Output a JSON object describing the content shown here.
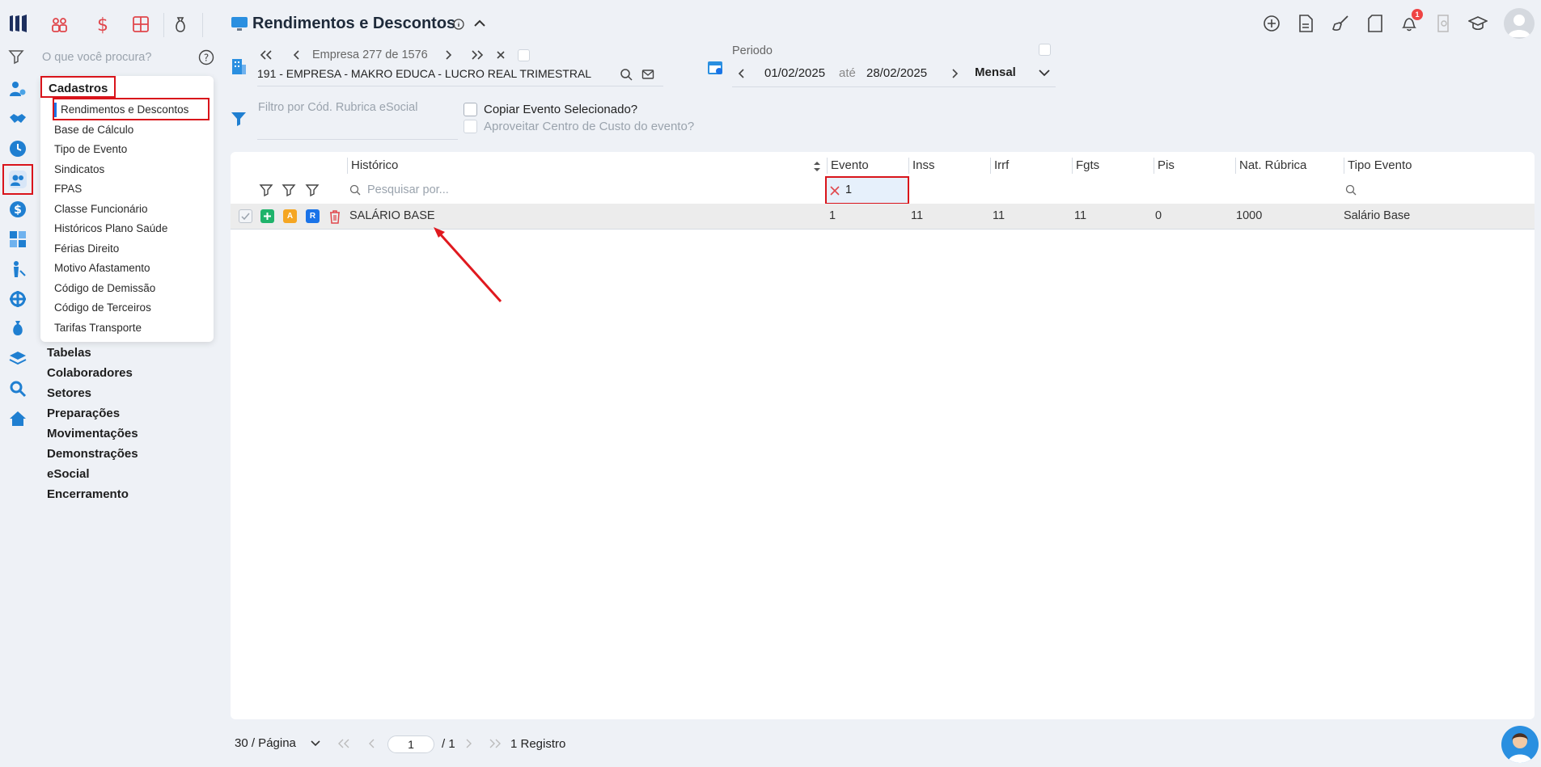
{
  "page": {
    "title": "Rendimentos e Descontos",
    "notification_count": "1"
  },
  "search": {
    "placeholder": "O que você procura?"
  },
  "menu": {
    "section_title": "Cadastros",
    "items": [
      "Rendimentos e Descontos",
      "Base de Cálculo",
      "Tipo de Evento",
      "Sindicatos",
      "FPAS",
      "Classe Funcionário",
      "Históricos Plano Saúde",
      "Férias Direito",
      "Motivo Afastamento",
      "Código de Demissão",
      "Código de Terceiros",
      "Tarifas Transporte"
    ],
    "main_items": [
      "Tabelas",
      "Colaboradores",
      "Setores",
      "Preparações",
      "Movimentações",
      "Demonstrações",
      "eSocial",
      "Encerramento"
    ]
  },
  "company": {
    "label": "Empresa",
    "current": "277",
    "of_label": "de",
    "total": "1576",
    "name": "191 - EMPRESA - MAKRO EDUCA - LUCRO REAL TRIMESTRAL"
  },
  "period": {
    "label": "Periodo",
    "start": "01/02/2025",
    "until_label": "até",
    "end": "28/02/2025",
    "mode": "Mensal"
  },
  "filter": {
    "placeholder": "Filtro por Cód. Rubrica eSocial",
    "copy_event_label": "Copiar Evento Selecionado?",
    "reuse_cost_center_label": "Aproveitar Centro de Custo do evento?"
  },
  "table": {
    "columns": [
      "Histórico",
      "Evento",
      "Inss",
      "Irrf",
      "Fgts",
      "Pis",
      "Nat. Rúbrica",
      "Tipo Evento"
    ],
    "search_placeholder": "Pesquisar por...",
    "evento_filter_value": "1",
    "row_badge_a": "A",
    "row_badge_r": "R",
    "rows": [
      {
        "historico": "SALÁRIO BASE",
        "evento": "1",
        "inss": "11",
        "irrf": "11",
        "fgts": "11",
        "pis": "0",
        "nat_rubrica": "1000",
        "tipo_evento": "Salário Base"
      }
    ]
  },
  "pagination": {
    "per_page": "30 / Página",
    "page": "1",
    "total_pages": "/ 1",
    "records": "1 Registro"
  },
  "colors": {
    "accent_blue": "#1a73e8",
    "highlight_red": "#d9141b",
    "annotation_arrow": "#e0191f"
  }
}
